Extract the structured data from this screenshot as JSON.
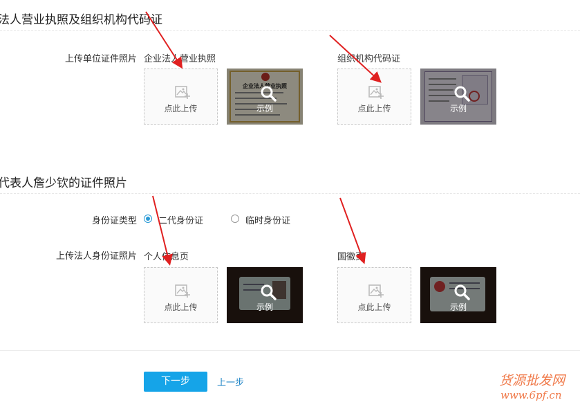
{
  "section1": {
    "title": "法人营业执照及组织机构代码证",
    "upload_label": "上传单位证件照片",
    "items": [
      {
        "caption": "企业法人营业执照",
        "upload_text": "点此上传",
        "sample_text": "示例",
        "sample_heading": "企业法人营业执照"
      },
      {
        "caption": "组织机构代码证",
        "upload_text": "点此上传",
        "sample_text": "示例"
      }
    ]
  },
  "section2": {
    "title": "代表人詹少钦的证件照片",
    "id_type_label": "身份证类型",
    "id_type_options": [
      {
        "label": "二代身份证",
        "checked": true
      },
      {
        "label": "临时身份证",
        "checked": false
      }
    ],
    "upload_label": "上传法人身份证照片",
    "items": [
      {
        "caption": "个人信息页",
        "upload_text": "点此上传",
        "sample_text": "示例"
      },
      {
        "caption": "国徽页",
        "upload_text": "点此上传",
        "sample_text": "示例"
      }
    ]
  },
  "actions": {
    "next_label": "下一步",
    "prev_label": "上一步"
  },
  "watermark": {
    "line1": "货源批发网",
    "line2": "www.6pf.cn"
  },
  "colors": {
    "primary": "#15a4e8",
    "link": "#1a82c4",
    "arrow": "#e02020",
    "watermark": "#f07a4a"
  },
  "icons": [
    "image-placeholder-icon",
    "magnifier-icon",
    "radio-icon",
    "arrow-annotation"
  ]
}
